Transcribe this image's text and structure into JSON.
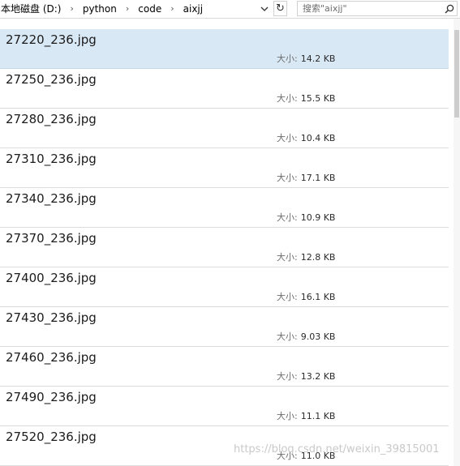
{
  "address_bar": {
    "crumbs": [
      "本地磁盘 (D:)",
      "python",
      "code",
      "aixjj"
    ],
    "dropdown_icon": "chevron-down",
    "refresh_icon": "refresh"
  },
  "search": {
    "placeholder": "搜索\"aixjj\"",
    "icon": "search"
  },
  "files": {
    "size_label": "大小:",
    "items": [
      {
        "name": "27220_236.jpg",
        "size": "14.2 KB",
        "selected": true
      },
      {
        "name": "27250_236.jpg",
        "size": "15.5 KB"
      },
      {
        "name": "27280_236.jpg",
        "size": "10.4 KB"
      },
      {
        "name": "27310_236.jpg",
        "size": "17.1 KB"
      },
      {
        "name": "27340_236.jpg",
        "size": "10.9 KB"
      },
      {
        "name": "27370_236.jpg",
        "size": "12.8 KB"
      },
      {
        "name": "27400_236.jpg",
        "size": "16.1 KB"
      },
      {
        "name": "27430_236.jpg",
        "size": "9.03 KB"
      },
      {
        "name": "27460_236.jpg",
        "size": "13.2 KB"
      },
      {
        "name": "27490_236.jpg",
        "size": "11.1 KB"
      },
      {
        "name": "27520_236.jpg",
        "size": "11.0 KB"
      }
    ]
  },
  "watermark": "https://blog.csdn.net/weixin_39815001",
  "colors": {
    "selected_bg": "#d9e8f5",
    "divider": "#dcdcdc"
  }
}
